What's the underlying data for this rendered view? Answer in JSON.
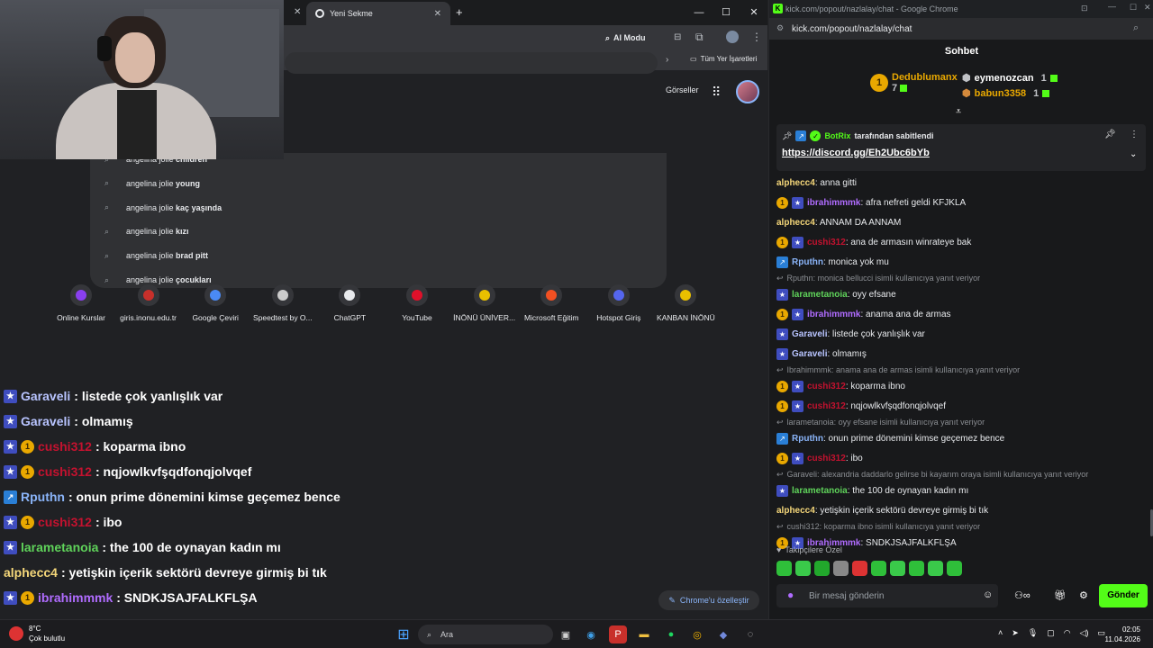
{
  "left_browser": {
    "tab_title": "Yeni Sekme",
    "ai_mode": "AI Modu",
    "bookmarks_all": "Tüm Yer İşaretleri",
    "images_link": "Görseller",
    "suggestions": [
      {
        "prefix": "angelina jolie ",
        "bold": "children"
      },
      {
        "prefix": "angelina jolie ",
        "bold": "young"
      },
      {
        "prefix": "angelina jolie ",
        "bold": "kaç yaşında"
      },
      {
        "prefix": "angelina jolie ",
        "bold": "kızı"
      },
      {
        "prefix": "angelina jolie ",
        "bold": "brad pitt"
      },
      {
        "prefix": "angelina jolie ",
        "bold": "çocukları"
      }
    ],
    "shortcuts": [
      "Online Kurslar",
      "giris.inonu.edu.tr",
      "Google Çeviri",
      "Speedtest by O...",
      "ChatGPT",
      "YouTube",
      "İNÖNÜ ÜNİVER...",
      "Microsoft Eğitim",
      "Hotspot Giriş",
      "KANBAN İNÖNÜ"
    ],
    "customize": "Chrome'u özelleştir"
  },
  "overlay_chat": [
    {
      "user": "Garaveli",
      "msg": " : listede çok yanlışlık var",
      "color": "#b8c4ff",
      "badges": [
        "star"
      ]
    },
    {
      "user": "Garaveli",
      "msg": " : olmamış",
      "color": "#b8c4ff",
      "badges": [
        "star"
      ]
    },
    {
      "user": "cushi312",
      "msg": " : koparma ibno",
      "color": "#c4122f",
      "badges": [
        "star",
        "gold"
      ]
    },
    {
      "user": "cushi312",
      "msg": " : nqjowlkvfşqdfonqjolvqef",
      "color": "#c4122f",
      "badges": [
        "star",
        "gold"
      ]
    },
    {
      "user": "Rputhn",
      "msg": " : onun prime dönemini kimse geçemez bence",
      "color": "#8ab4f8",
      "badges": [
        "bot"
      ]
    },
    {
      "user": "cushi312",
      "msg": " : ibo",
      "color": "#c4122f",
      "badges": [
        "star",
        "gold"
      ]
    },
    {
      "user": "larametanoia",
      "msg": " : the 100 de oynayan kadın mı",
      "color": "#5fd35a",
      "badges": [
        "star"
      ]
    },
    {
      "user": "alphecc4",
      "msg": " : yetişkin içerik sektörü devreye girmiş bi tık",
      "color": "#f5d77a",
      "badges": []
    },
    {
      "user": "ibrahimmmk",
      "msg": " : SNDKJSAJFALKFLŞA",
      "color": "#b06cff",
      "badges": [
        "star",
        "gold"
      ]
    }
  ],
  "right_window": {
    "title": "kick.com/popout/nazlalay/chat - Google Chrome",
    "address": "kick.com/popout/nazlalay/chat",
    "header": "Sohbet",
    "gifters": [
      {
        "name": "Dedublumanx",
        "count": "7"
      },
      {
        "name": "eymenozcan",
        "count": "1"
      },
      {
        "name": "babun3358",
        "count": "1"
      }
    ],
    "pinned_by": "BotRix",
    "pinned_suffix": " tarafından sabitlendi",
    "pinned_link": "https://discord.gg/Eh2Ubc6bYb",
    "followers_label": "Takipçilere Özel",
    "input_placeholder": "Bir mesaj gönderin",
    "send_label": "Gönder"
  },
  "chat": [
    {
      "type": "msg",
      "user": "alphecc4",
      "text": ": anna gitti",
      "color": "#f5d77a",
      "badges": []
    },
    {
      "type": "msg",
      "user": "ibrahimmmk",
      "text": ": afra nefreti geldi KFJKLA",
      "color": "#b06cff",
      "badges": [
        "gold",
        "star"
      ]
    },
    {
      "type": "msg",
      "user": "alphecc4",
      "text": ": ANNAM DA ANNAM",
      "color": "#f5d77a",
      "badges": []
    },
    {
      "type": "msg",
      "user": "cushi312",
      "text": ": ana de armasın winrateye bak",
      "color": "#c4122f",
      "badges": [
        "gold",
        "star"
      ]
    },
    {
      "type": "msg",
      "user": "Rputhn",
      "text": ": monica yok mu",
      "color": "#8ab4f8",
      "badges": [
        "bot"
      ]
    },
    {
      "type": "reply",
      "text": "Rputhn: monica bellucci isimli kullanıcıya yanıt veriyor"
    },
    {
      "type": "msg",
      "user": "larametanoia",
      "text": ": oyy efsane",
      "color": "#5fd35a",
      "badges": [
        "star"
      ]
    },
    {
      "type": "msg",
      "user": "ibrahimmmk",
      "text": ": anama ana de armas",
      "color": "#b06cff",
      "badges": [
        "gold",
        "star"
      ]
    },
    {
      "type": "msg",
      "user": "Garaveli",
      "text": ": listede çok yanlışlık var",
      "color": "#b8c4ff",
      "badges": [
        "star"
      ]
    },
    {
      "type": "msg",
      "user": "Garaveli",
      "text": ": olmamış",
      "color": "#b8c4ff",
      "badges": [
        "star"
      ]
    },
    {
      "type": "reply",
      "text": "Ibrahimmmk: anama ana de armas isimli kullanıcıya yanıt veriyor"
    },
    {
      "type": "msg",
      "user": "cushi312",
      "text": ": koparma ibno",
      "color": "#c4122f",
      "badges": [
        "gold",
        "star"
      ]
    },
    {
      "type": "msg",
      "user": "cushi312",
      "text": ": nqjowlkvfşqdfonqjolvqef",
      "color": "#c4122f",
      "badges": [
        "gold",
        "star"
      ]
    },
    {
      "type": "reply",
      "text": "larametanoia: oyy efsane isimli kullanıcıya yanıt veriyor"
    },
    {
      "type": "msg",
      "user": "Rputhn",
      "text": ": onun prime dönemini kimse geçemez bence",
      "color": "#8ab4f8",
      "badges": [
        "bot"
      ]
    },
    {
      "type": "msg",
      "user": "cushi312",
      "text": ": ibo",
      "color": "#c4122f",
      "badges": [
        "gold",
        "star"
      ]
    },
    {
      "type": "reply",
      "text": "Garaveli: alexandria daddarlo gelirse bi kayarım oraya isimli kullanıcıya yanıt veriyor"
    },
    {
      "type": "msg",
      "user": "larametanoia",
      "text": ": the 100 de oynayan kadın mı",
      "color": "#5fd35a",
      "badges": [
        "star"
      ]
    },
    {
      "type": "msg",
      "user": "alphecc4",
      "text": ": yetişkin içerik sektörü devreye girmiş bi tık",
      "color": "#f5d77a",
      "badges": []
    },
    {
      "type": "reply",
      "text": "cushi312: koparma ibno isimli kullanıcıya yanıt veriyor"
    },
    {
      "type": "msg",
      "user": "ibrahimmmk",
      "text": ": SNDKJSAJFALKFLŞA",
      "color": "#b06cff",
      "badges": [
        "gold",
        "star"
      ]
    }
  ],
  "taskbar": {
    "temperature": "8°C",
    "weather": "Çok bulutlu",
    "search": "Ara",
    "time": "02:05",
    "date": "11.04.2026"
  }
}
